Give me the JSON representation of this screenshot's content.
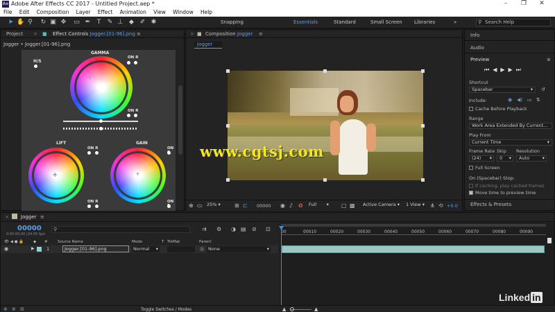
{
  "window": {
    "title": "Adobe After Effects CC 2017 - Untitled Project.aep *",
    "logo": "Ae"
  },
  "menu": [
    "File",
    "Edit",
    "Composition",
    "Layer",
    "Effect",
    "Animation",
    "View",
    "Window",
    "Help"
  ],
  "toolbar": {
    "snapping": "Snapping",
    "workspaces": [
      "Essentials",
      "Standard",
      "Small Screen",
      "Libraries"
    ],
    "search_placeholder": "Search Help"
  },
  "left_panel": {
    "tab_project": "Project",
    "tab_effect_controls_prefix": "Effect Controls",
    "tab_effect_controls_layer": "Jogger.[01-96].png",
    "breadcrumb": "Jogger • Jogger.[01-96].png",
    "wheels": {
      "gamma": "GAMMA",
      "lift": "LIFT",
      "gain": "GAIN",
      "hs": "H/S",
      "onr": "ON R"
    }
  },
  "composition": {
    "tab_prefix": "Composition",
    "tab_name": "Jogger",
    "sub_tab": "Jogger",
    "watermark": "www.cgtsj.com",
    "footer": {
      "zoom": "25%",
      "timecode": "00000",
      "resolution": "Full",
      "camera": "Active Camera",
      "views": "1 View",
      "exposure": "+0.0"
    }
  },
  "right_panel": {
    "info": "Info",
    "audio": "Audio",
    "preview": "Preview",
    "shortcut_label": "Shortcut",
    "shortcut_value": "Spacebar",
    "include_label": "Include:",
    "cache_before": "Cache Before Playback",
    "range_label": "Range",
    "range_value": "Work Area Extended By Current...",
    "play_from_label": "Play From",
    "play_from_value": "Current Time",
    "frame_rate_label": "Frame Rate",
    "skip_label": "Skip",
    "resolution_label": "Resolution",
    "frame_rate_value": "(24)",
    "skip_value": "0",
    "resolution_value": "Auto",
    "full_screen": "Full Screen",
    "on_stop_label": "On (Spacebar) Stop:",
    "if_caching": "If caching, play cached frames",
    "move_time": "Move time to preview time",
    "effects_presets": "Effects & Presets"
  },
  "timeline": {
    "tab": "Jogger",
    "timecode": "00000",
    "timecode_sub": "0:00:00:00 (24.00 fps)",
    "search_placeholder": "",
    "columns": {
      "source": "Source Name",
      "mode": "Mode",
      "t": "T",
      "trkmat": "TrkMat",
      "parent": "Parent"
    },
    "layer": {
      "index": "1",
      "name": "Jogger.[01-96].png",
      "mode": "Normal",
      "parent": "None"
    },
    "ruler": [
      "00010",
      "00020",
      "00030",
      "00040",
      "00050",
      "00060",
      "00070",
      "00080",
      "00090"
    ],
    "ruler_start": "00",
    "toggle": "Toggle Switches / Modes"
  },
  "watermark_brand": "Linked"
}
